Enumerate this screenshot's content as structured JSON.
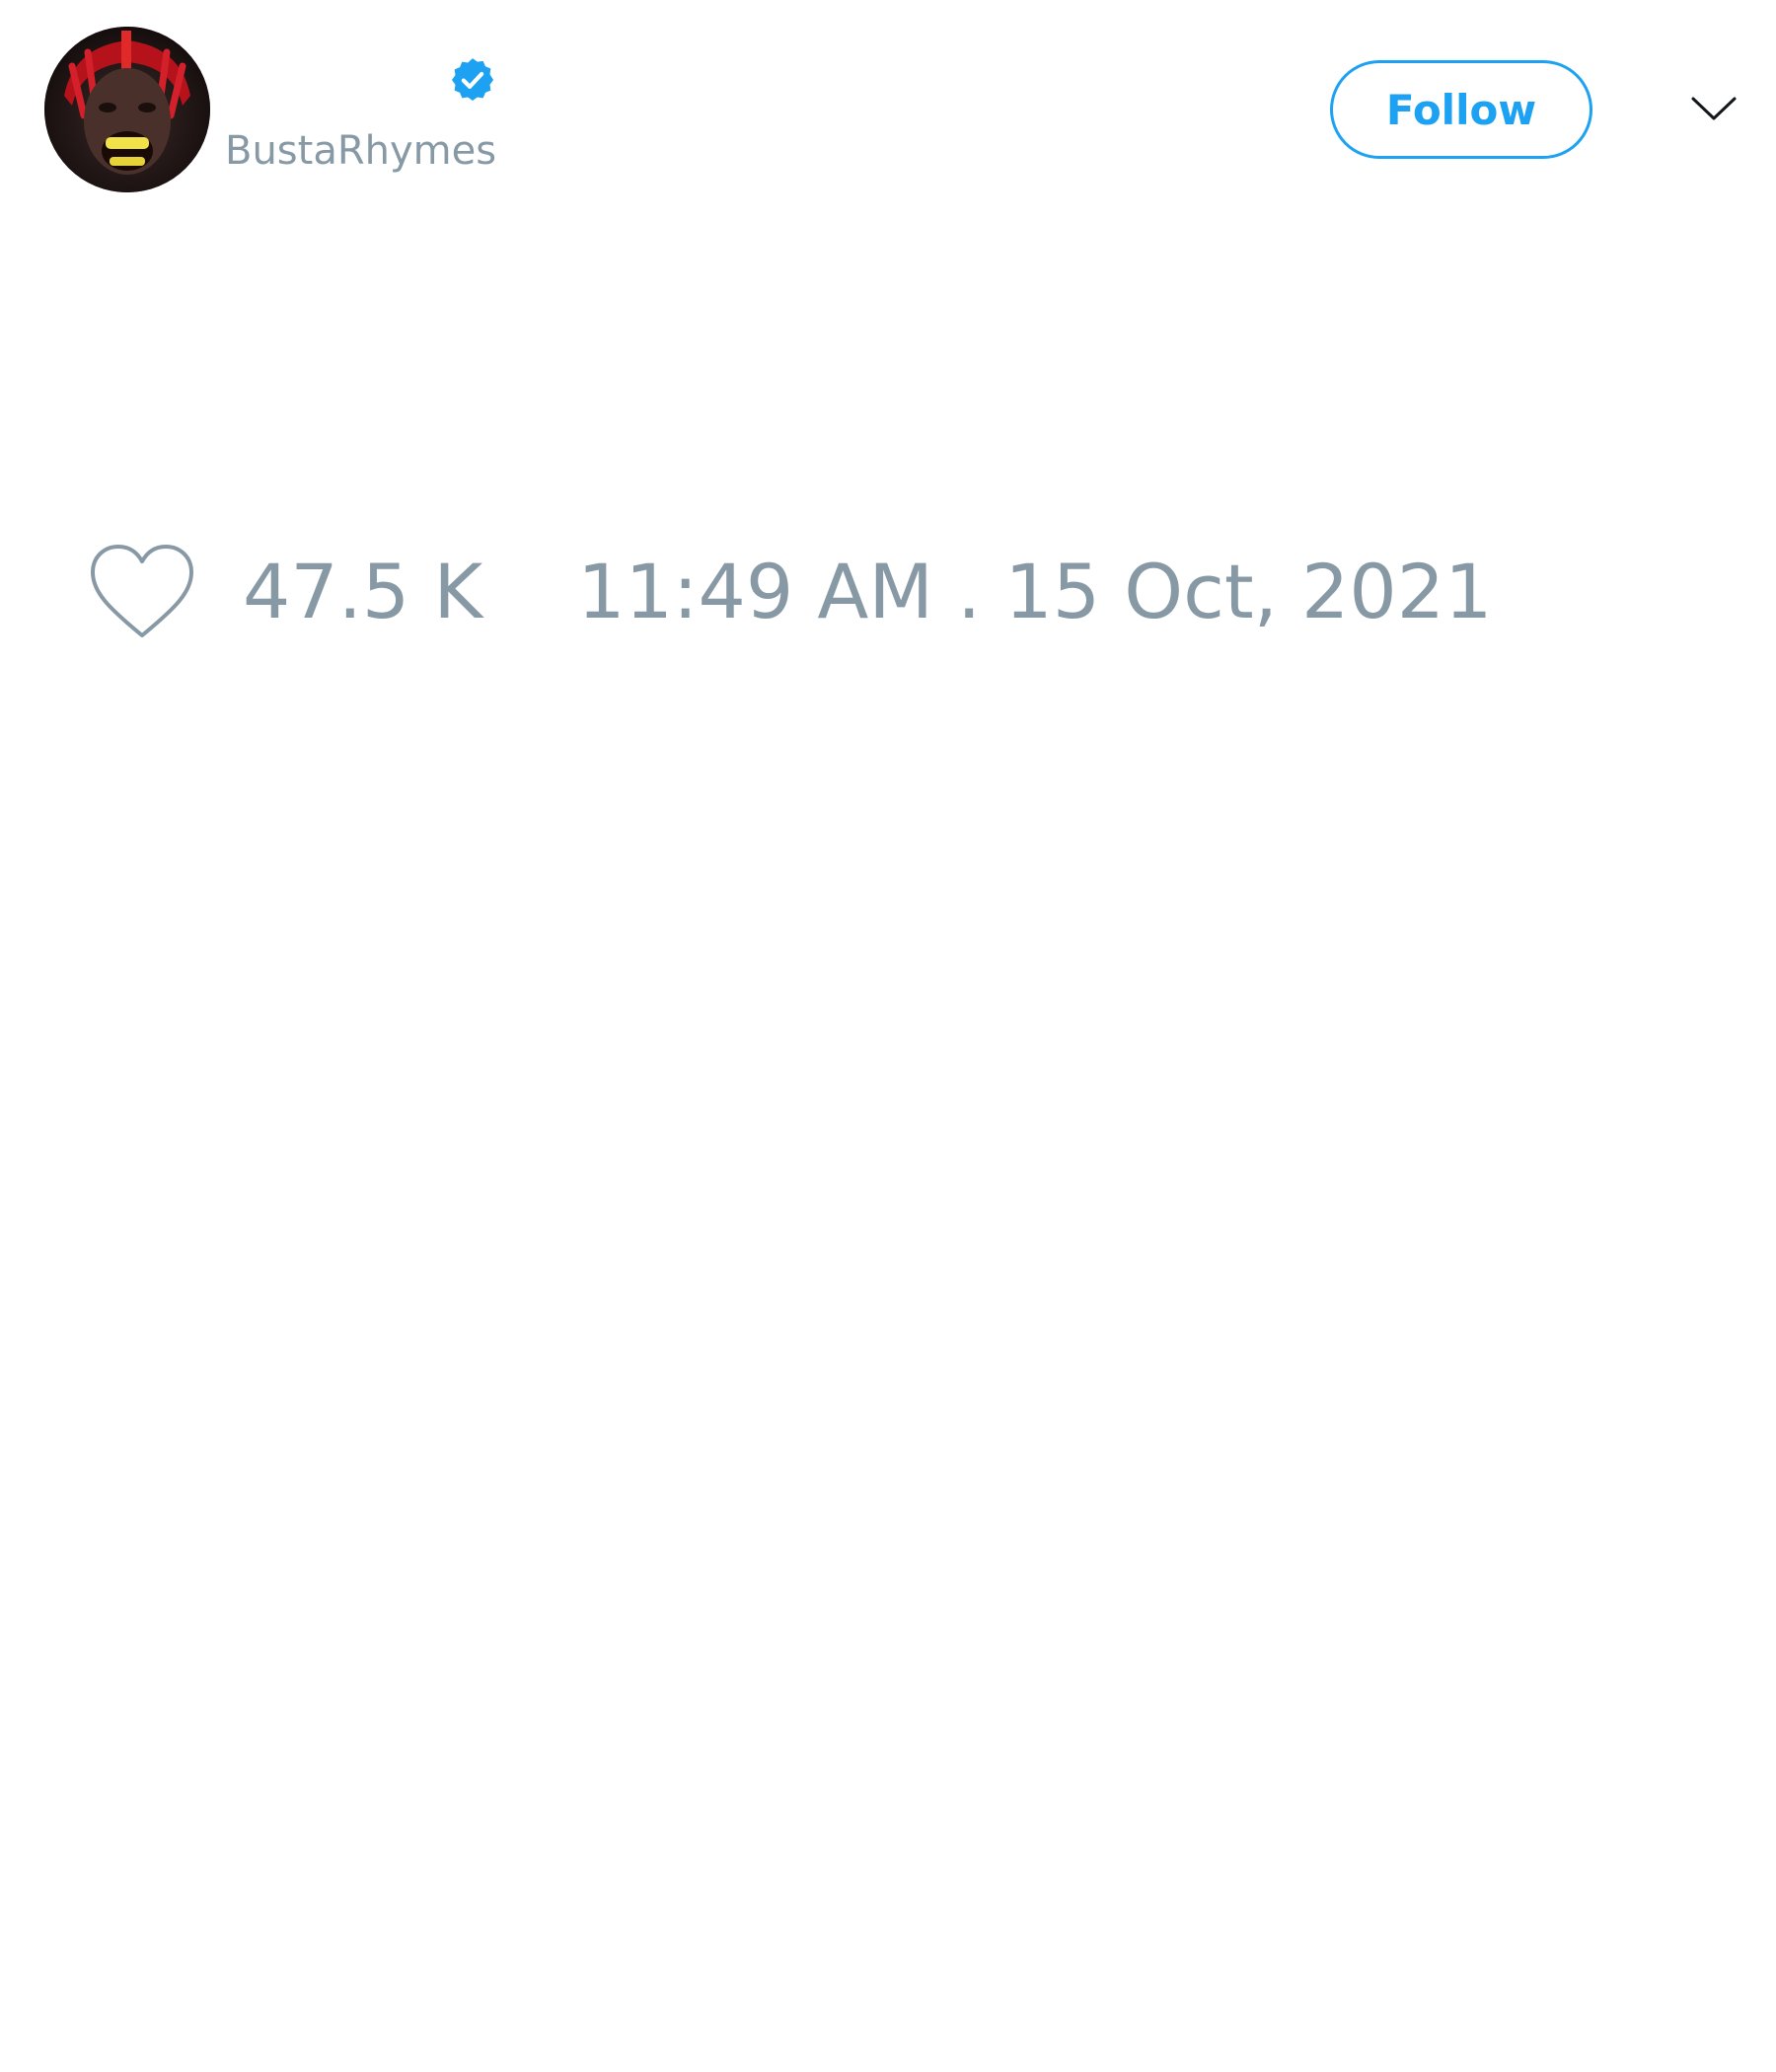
{
  "tweet": {
    "author": {
      "display_name": "",
      "handle": "BustaRhymes",
      "verified": true,
      "avatar": "avatar-photo"
    },
    "follow_label": "Follow",
    "menu_icon": "chevron-down-icon",
    "likes": {
      "icon": "heart-icon",
      "count": "47.5 K"
    },
    "timestamp": "11:49 AM . 15 Oct, 2021"
  },
  "colors": {
    "accent": "#1da1f2",
    "muted_text": "#8899a6",
    "background": "#ffffff"
  }
}
